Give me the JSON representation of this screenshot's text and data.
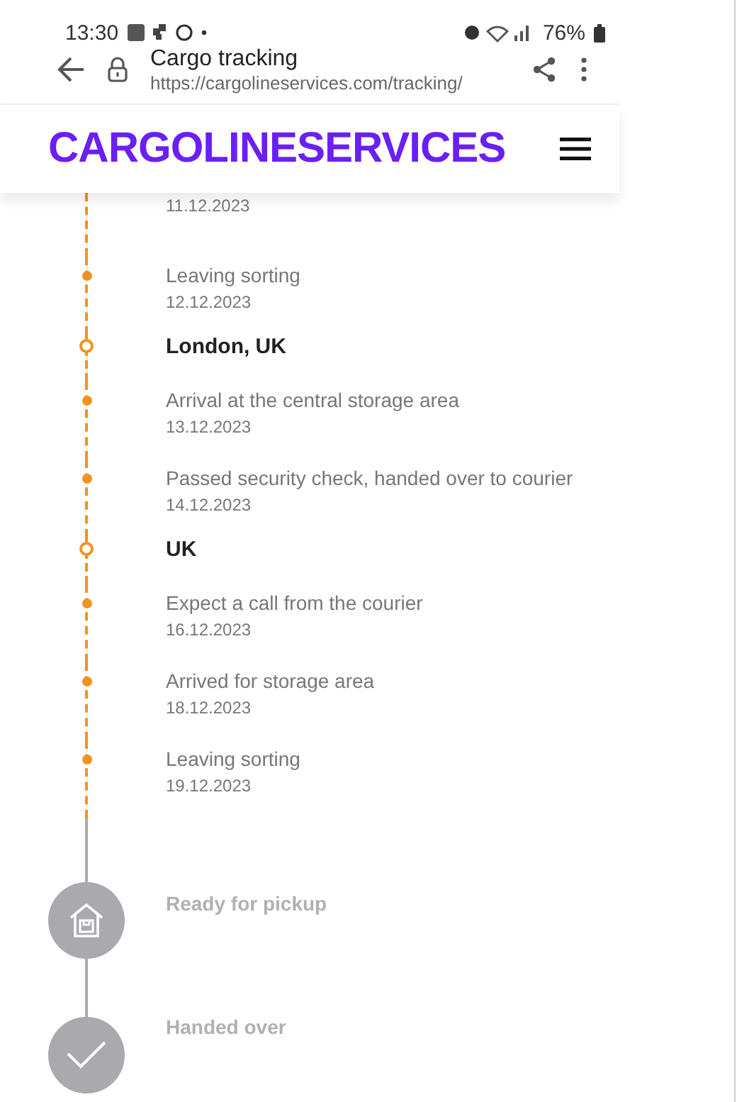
{
  "status_bar": {
    "time": "13:30",
    "battery": "76%"
  },
  "browser": {
    "title": "Cargo tracking",
    "url": "https://cargolineservices.com/tracking/"
  },
  "site_header": {
    "logo": "CARGOLINESERVICES"
  },
  "timeline": [
    {
      "kind": "event",
      "date": "11.12.2023"
    },
    {
      "kind": "event",
      "text": "Leaving sorting",
      "date": "12.12.2023"
    },
    {
      "kind": "place",
      "text": "London, UK"
    },
    {
      "kind": "event",
      "text": "Arrival at the central storage area",
      "date": "13.12.2023"
    },
    {
      "kind": "event",
      "text": "Passed security check, handed over to courier",
      "date": "14.12.2023"
    },
    {
      "kind": "place",
      "text": "UK"
    },
    {
      "kind": "event",
      "text": "Expect a call from the courier",
      "date": "16.12.2023"
    },
    {
      "kind": "event",
      "text": "Arrived for storage area",
      "date": "18.12.2023"
    },
    {
      "kind": "event",
      "text": "Leaving sorting",
      "date": "19.12.2023"
    },
    {
      "kind": "pickup",
      "text": "Ready for pickup",
      "completed": false
    },
    {
      "kind": "handover",
      "text": "Handed over",
      "completed": false
    }
  ]
}
